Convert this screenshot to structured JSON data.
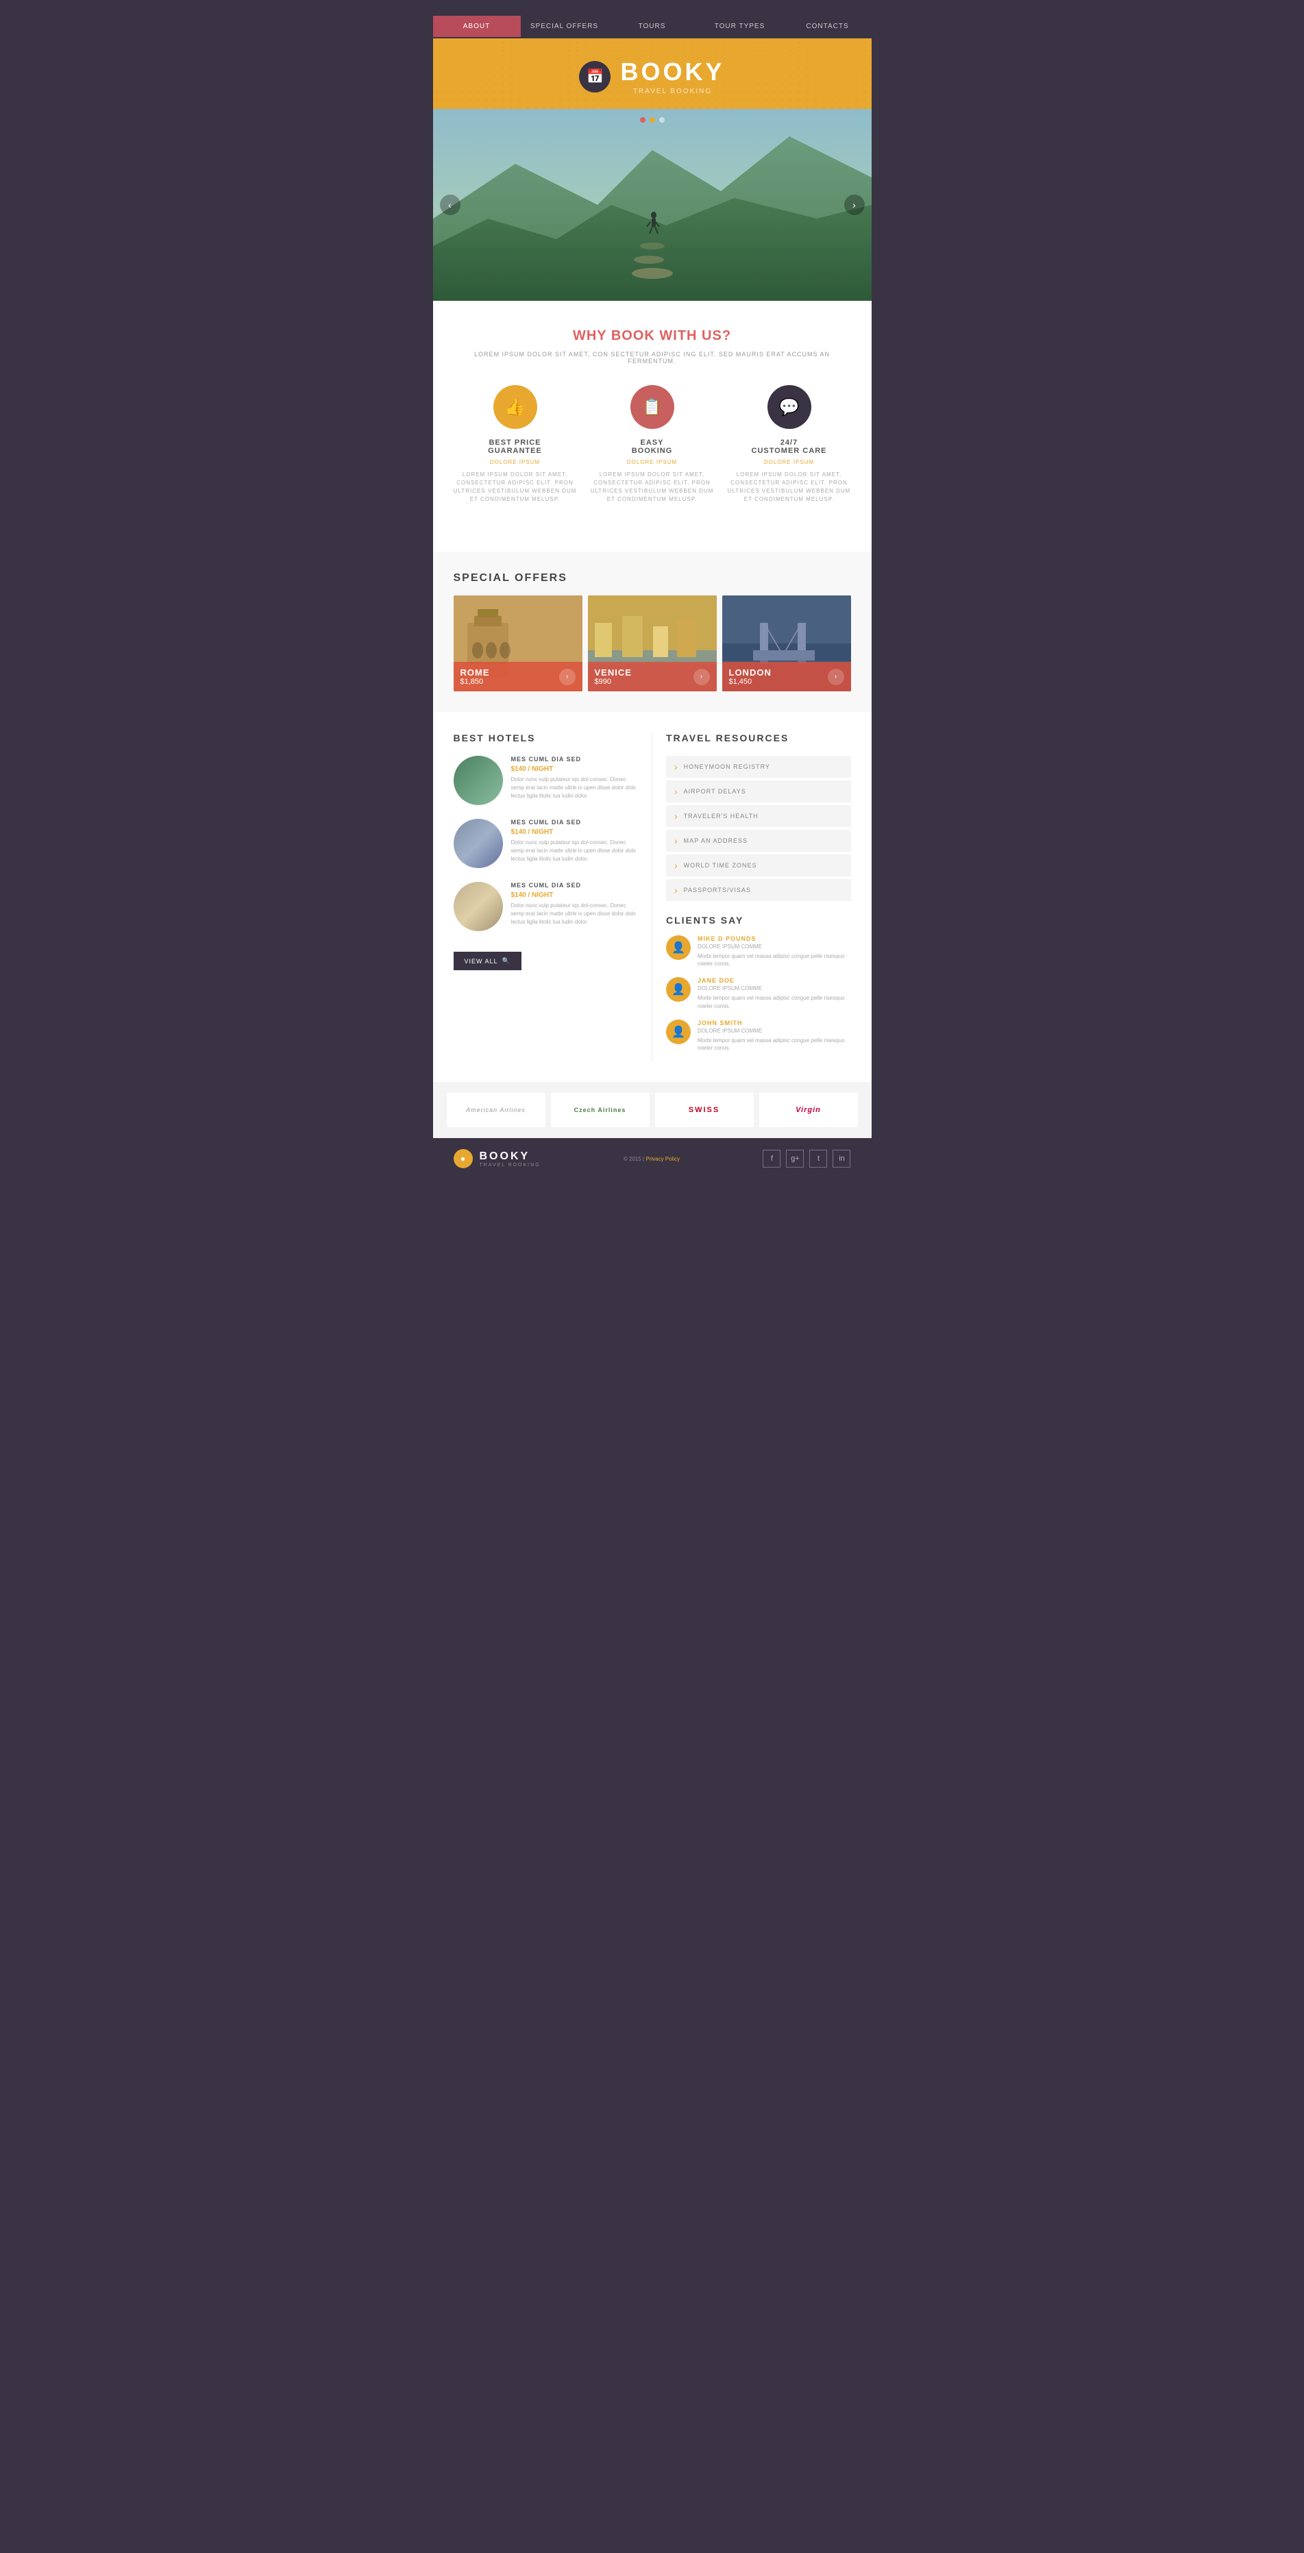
{
  "nav": {
    "items": [
      {
        "label": "ABOUT",
        "active": true
      },
      {
        "label": "SPECIAL OFFERS",
        "active": false
      },
      {
        "label": "TOURS",
        "active": false
      },
      {
        "label": "TOUR TYPES",
        "active": false
      },
      {
        "label": "CONTACTS",
        "active": false
      }
    ]
  },
  "header": {
    "title": "BOOKY",
    "subtitle": "TRAVEL BOOKING",
    "icon": "📅"
  },
  "hero": {
    "dots": [
      "active",
      "active2",
      ""
    ],
    "prev_label": "‹",
    "next_label": "›"
  },
  "why_book": {
    "title": "WHY BOOK WITH US?",
    "subtitle": "LOREM IPSUM DOLOR SIT AMET, CON SECTETUR ADIPISC ING ELIT. SED MAURIS ERAT ACCUMS AN FERMENTUM.",
    "features": [
      {
        "icon": "👍",
        "icon_class": "yellow",
        "title": "BEST PRICE\nGUARANTEE",
        "subtitle": "DOLORE IPSUM",
        "text": "Lorem ipsum dolor sit amet, consectetur adipisc elit. Pron ultrices vestibulum webben dum et condimentum melusp."
      },
      {
        "icon": "📋",
        "icon_class": "red",
        "title": "EASY\nBOOKING",
        "subtitle": "DOLORE IPSUM",
        "text": "Lorem ipsum dolor sit amet, consectetur adipisc elit. Pron ultrices vestibulum webben dum et condimentum melusp."
      },
      {
        "icon": "💬",
        "icon_class": "dark",
        "title": "24/7\nCUSTOMER CARE",
        "subtitle": "DOLORE IPSUM",
        "text": "Lorem ipsum dolor sit amet, consectetur adipisc elit. Pron ultrices vestibulum webben dum et condimentum melusp."
      }
    ]
  },
  "special_offers": {
    "title": "SPECIAL OFFERS",
    "offers": [
      {
        "city": "ROME",
        "price": "$1,850",
        "img_class": "rome"
      },
      {
        "city": "VENICE",
        "price": "$990",
        "img_class": "venice"
      },
      {
        "city": "LONDON",
        "price": "$1,450",
        "img_class": "london"
      }
    ]
  },
  "best_hotels": {
    "title": "BEST HOTELS",
    "hotels": [
      {
        "name": "MES CUML DIA SED",
        "price": "$140 / NIGHT",
        "text": "Dolor nunc vulp putateur iqs dol-consec. Donec semp erat lacin matte ultrle ix upen disse dolor dolo lectus ligila litolic lua ludin dolor.",
        "img_class": "h1"
      },
      {
        "name": "MES CUML DIA SED",
        "price": "$140 / NIGHT",
        "text": "Dolor nunc vulp putateur iqs dol-consec. Donec semp erat lacin matte ultrle ix upen disse dolor dolo lectus ligila litolic lua ludin dolor.",
        "img_class": "h2"
      },
      {
        "name": "MES CUML DIA SED",
        "price": "$140 / NIGHT",
        "text": "Dolor nunc vulp putateur iqs dol-consec. Donec semp erat lacin matte ultrle ix upen disse dolor dolo lectus ligila litolic lua ludin dolor.",
        "img_class": "h3"
      }
    ],
    "view_all": "VIEW ALL"
  },
  "travel_resources": {
    "title": "TRAVEL RESOURCES",
    "items": [
      "HONEYMOON REGISTRY",
      "AIRPORT DELAYS",
      "TRAVELER'S HEALTH",
      "MAP AN ADDRESS",
      "WORLD TIME ZONES",
      "PASSPORTS/VISAS"
    ]
  },
  "clients_say": {
    "title": "CLIENTS SAY",
    "clients": [
      {
        "name": "MIKE D POUNDS",
        "role": "DOLORE IPSUM COMME",
        "text": "Morbi tempor quam vel massa adipisc congue pelle risesquo roieler comis."
      },
      {
        "name": "JANE DOE",
        "role": "DOLORE IPSUM COMME",
        "text": "Morbi tempor quam vel massa adipisc congue pelle risesquo roieler comis."
      },
      {
        "name": "JOHN SMITH",
        "role": "DOLORE IPSUM COMME",
        "text": "Morbi tempor quam vel massa adipisc congue pelle risesquo roieler comis."
      }
    ]
  },
  "airlines": {
    "logos": [
      "American Airlines",
      "Czech Airlines",
      "SWISS",
      "Virgin"
    ]
  },
  "footer": {
    "brand": "BOOKY",
    "subtitle": "TRAVEL BOOKING",
    "copyright": "© 2015 |",
    "privacy_link": "Privacy Policy",
    "social": [
      "f",
      "g+",
      "t",
      "in"
    ]
  }
}
